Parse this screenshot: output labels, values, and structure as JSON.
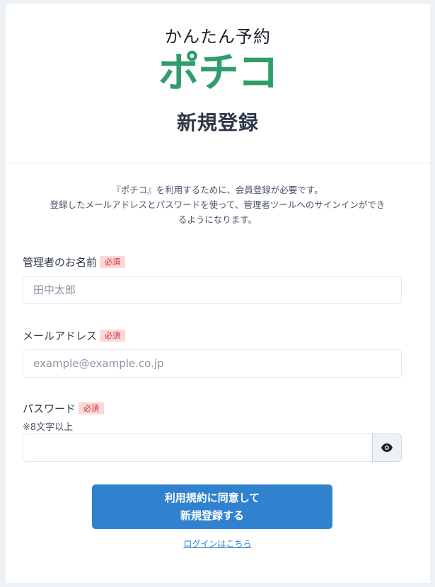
{
  "header": {
    "tagline": "かんたん予約",
    "logo": "ポチコ",
    "title": "新規登録"
  },
  "intro": {
    "line1": "『ポチコ』を利用するために、会員登録が必要です。",
    "line2": "登録したメールアドレスとパスワードを使って、管理者ツールへのサインインができ",
    "line3": "るようになります。"
  },
  "form": {
    "name": {
      "label": "管理者のお名前",
      "badge": "必須",
      "placeholder": "田中太郎",
      "value": ""
    },
    "email": {
      "label": "メールアドレス",
      "badge": "必須",
      "placeholder": "example@example.co.jp",
      "value": ""
    },
    "password": {
      "label": "パスワード",
      "badge": "必須",
      "hint": "※8文字以上",
      "value": "",
      "toggle_icon": "eye-icon"
    },
    "submit": {
      "line1": "利用規約に同意して",
      "line2": "新規登録する"
    },
    "login_link": "ログインはこちら"
  },
  "colors": {
    "brand": "#2f9e6a",
    "primary": "#3182ce",
    "badge_bg": "#fed7d7",
    "badge_text": "#c53030",
    "page_bg": "#edf2f6"
  }
}
